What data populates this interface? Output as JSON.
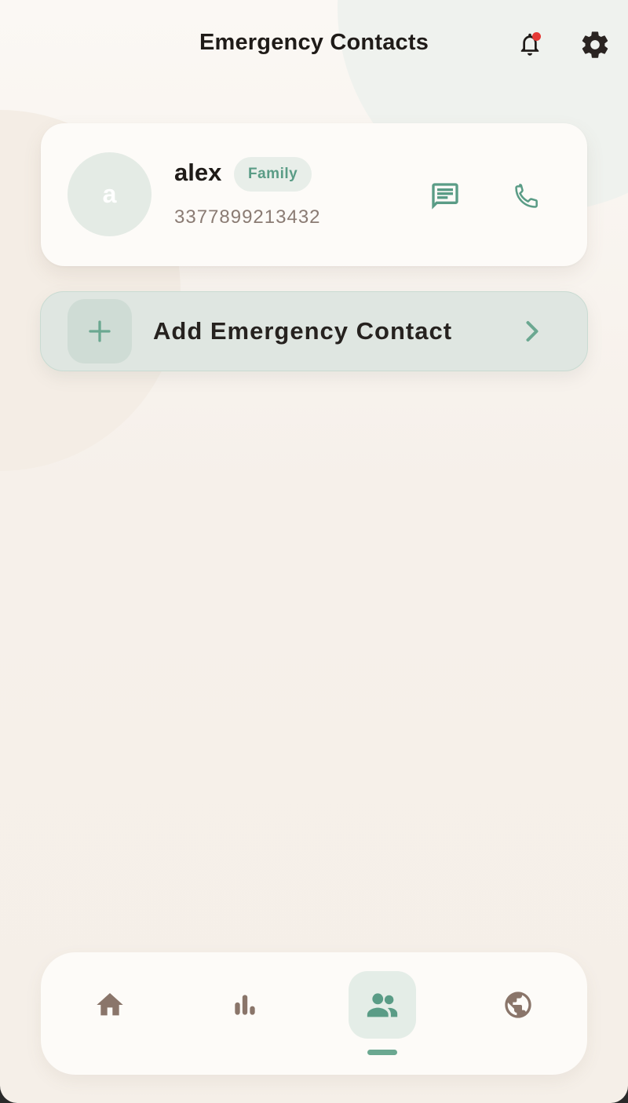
{
  "header": {
    "title": "Emergency Contacts",
    "notification_icon": "bell-icon",
    "settings_icon": "gear-icon",
    "has_unread_notifications": true
  },
  "contacts": [
    {
      "initial": "a",
      "name": "alex",
      "relation": "Family",
      "phone": "3377899213432",
      "message_icon": "message-icon",
      "call_icon": "phone-icon"
    }
  ],
  "add_contact": {
    "label": "Add Emergency Contact",
    "icon": "plus-icon",
    "chevron_icon": "chevron-right-icon"
  },
  "bottom_nav": {
    "items": [
      {
        "icon": "home-icon",
        "active": false
      },
      {
        "icon": "bar-chart-icon",
        "active": false
      },
      {
        "icon": "people-icon",
        "active": true
      },
      {
        "icon": "globe-icon",
        "active": false
      }
    ]
  },
  "colors": {
    "accent": "#5a9c86",
    "text_primary": "#1f1b18",
    "text_secondary": "#8a7b73",
    "nav_icon": "#8a756a",
    "notification_dot": "#e53935"
  }
}
